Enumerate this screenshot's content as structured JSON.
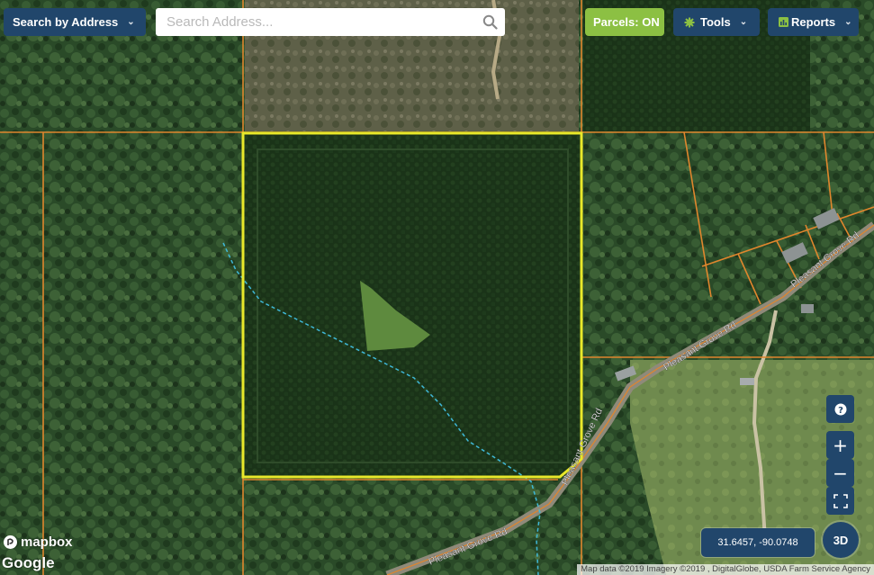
{
  "toolbar": {
    "search_mode_label": "Search by Address",
    "search_placeholder": "Search Address...",
    "parcels_label": "Parcels: ON",
    "tools_label": "Tools",
    "reports_label": "Reports"
  },
  "map": {
    "road_label_1": "Pleasant Grove Rd",
    "road_label_2": "Pleasant Grove Rd",
    "road_label_3": "Pleasant Grove Rd",
    "road_label_4": "Pleasant Grove Rd",
    "parcel_line_color": "#e0862d",
    "selected_parcel_color": "#e8e82a",
    "creek_color": "#3fb8d8"
  },
  "controls": {
    "help_icon": "question-circle-icon",
    "zoom_in": "+",
    "zoom_out": "−",
    "coordinates": "31.6457, -90.0748",
    "three_d_label": "3D"
  },
  "footer": {
    "mapbox_label": "mapbox",
    "google_label": "Google",
    "attribution": "Map data ©2019 Imagery ©2019 , DigitalGlobe, USDA Farm Service Agency"
  }
}
